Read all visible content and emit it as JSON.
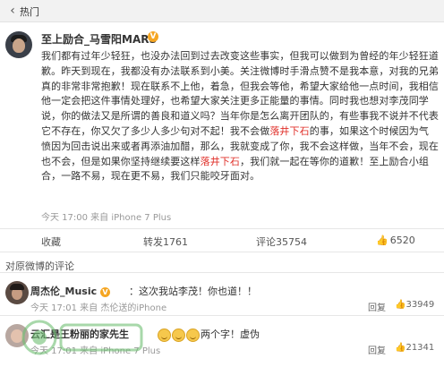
{
  "topbar": {
    "title": "热门"
  },
  "post": {
    "username": "至上励合_马雪阳MARS",
    "paragraph_parts": [
      {
        "text": "我们都有过年少轻狂，也没办法回到过去改变这些事实，但我可以做到为曾经的年少轻狂道歉。昨天到现在，我都没有办法联系到小美。关注微博时手滑点赞不是我本意，对我的兄弟真的非常非常抱歉！现在联系不上他，着急，但我会等他，希望大家给他一点时间，我相信他一定会把这件事情处理好，也希望大家关注更多正能量的事情。同时我也想对李茂同学说，你的做法又是所谓的善良和道义吗？当年你是怎么离开团队的，有些事我不说并不代表它不存在，你又欠了多少人多少句对不起！我不会做",
        "hl": false
      },
      {
        "text": "落井下石",
        "hl": true
      },
      {
        "text": "的事，如果这个时候因为气愤因为回击说出来或者再添油加醋，那么，我就变成了你，我不会这样做，当年不会，现在也不会，但是如果你坚持继续要这样",
        "hl": false
      },
      {
        "text": "落井下石",
        "hl": true
      },
      {
        "text": "，我们就一起在等你的道歉！至上励合小组合，一路不易，现在更不易，我们只能咬牙面对。",
        "hl": false
      }
    ],
    "meta": "今天 17:00 来自 iPhone 7 Plus"
  },
  "actions": {
    "collect": "收藏",
    "repost": "转发1761",
    "comment": "评论35754",
    "like": "6520"
  },
  "comments_section": {
    "label": "对原微博的评论"
  },
  "comments": [
    {
      "name": "周杰伦_Music",
      "text": "：这次我站李茂！你也道！！",
      "meta": "今天 17:01 来自 杰伦送的iPhone",
      "reply": "回复",
      "likes": "33949"
    },
    {
      "name": "云汇是王粉丽的家先生",
      "text": "两个字！虚伪",
      "meta": "今天 17:01 来自 iPhone 7 Plus",
      "reply": "回复",
      "likes": "21341"
    }
  ],
  "icons": {
    "back": "chevron-left-icon",
    "verified": "verified-v-icon",
    "like": "thumbs-up-icon"
  },
  "colors": {
    "highlight": "#e0302a",
    "verified": "#f5a623",
    "meta_text": "#999999",
    "topbar_bg": "#f2f2f2"
  }
}
